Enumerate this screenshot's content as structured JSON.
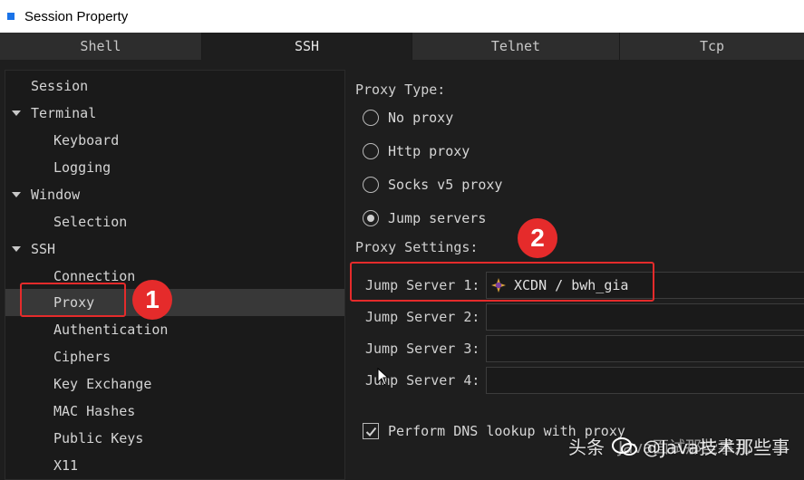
{
  "window": {
    "title": "Session Property"
  },
  "tabs": [
    {
      "label": "Shell",
      "active": false
    },
    {
      "label": "SSH",
      "active": true
    },
    {
      "label": "Telnet",
      "active": false
    },
    {
      "label": "Tcp",
      "active": false
    }
  ],
  "tree": [
    {
      "label": "Session"
    },
    {
      "label": "Terminal"
    },
    {
      "label": "Keyboard"
    },
    {
      "label": "Logging"
    },
    {
      "label": "Window"
    },
    {
      "label": "Selection"
    },
    {
      "label": "SSH"
    },
    {
      "label": "Connection"
    },
    {
      "label": "Proxy"
    },
    {
      "label": "Authentication"
    },
    {
      "label": "Ciphers"
    },
    {
      "label": "Key Exchange"
    },
    {
      "label": "MAC Hashes"
    },
    {
      "label": "Public Keys"
    },
    {
      "label": "X11"
    }
  ],
  "proxy_type": {
    "label": "Proxy Type:",
    "options": [
      {
        "label": "No proxy",
        "checked": false
      },
      {
        "label": "Http proxy",
        "checked": false
      },
      {
        "label": "Socks v5 proxy",
        "checked": false
      },
      {
        "label": "Jump servers",
        "checked": true
      }
    ]
  },
  "proxy_settings": {
    "label": "Proxy Settings:",
    "servers": [
      {
        "label": "Jump Server 1:",
        "value": "XCDN / bwh_gia"
      },
      {
        "label": "Jump Server 2:",
        "value": ""
      },
      {
        "label": "Jump Server 3:",
        "value": ""
      },
      {
        "label": "Jump Server 4:",
        "value": ""
      }
    ]
  },
  "dns_lookup": {
    "label": "Perform DNS lookup with proxy",
    "checked": true
  },
  "annotations": {
    "marker_1": "1",
    "marker_2": "2"
  },
  "watermark": {
    "source": "头条",
    "handle": "@Java技术那些事",
    "overlay": "Java面试那些事儿"
  },
  "colors": {
    "annotation_red": "#e52b2b",
    "selection_bg": "#383838",
    "title_icon": "#1a73e8"
  }
}
